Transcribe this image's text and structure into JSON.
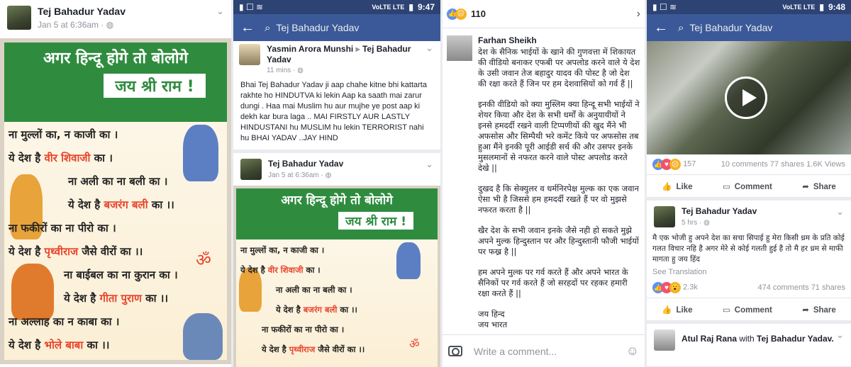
{
  "panel1": {
    "author": "Tej Bahadur Yadav",
    "time": "Jan 5 at 6:36am · ",
    "poster": {
      "headline": "अगर हिन्दू होगे तो बोलोगे",
      "jai": "जय श्री राम !",
      "lines": [
        {
          "pre": "ना मुल्लों का, न काजी का ।",
          "hl": "",
          "post": ""
        },
        {
          "pre": "ये देश है ",
          "hl": "वीर शिवाजी",
          "post": " का ।"
        },
        {
          "pre": "ना अली का ना बली का ।",
          "hl": "",
          "post": ""
        },
        {
          "pre": "ये देश है ",
          "hl": "बजरंग बली",
          "post": " का ।।"
        },
        {
          "pre": "ना फकीरों का ना पीरो का ।",
          "hl": "",
          "post": ""
        },
        {
          "pre": "ये देश है ",
          "hl": "पृथ्वीराज",
          "post": " जैसे वीरों का ।।"
        },
        {
          "pre": "ना बाईबल का ना कुरान का ।",
          "hl": "",
          "post": ""
        },
        {
          "pre": "ये देश है ",
          "hl": "गीता पुराण",
          "post": " का ।।"
        },
        {
          "pre": "ना अल्लाह का न काबा का ।",
          "hl": "",
          "post": ""
        },
        {
          "pre": "ये देश है ",
          "hl": "भोले बाबा",
          "post": " का ।।"
        }
      ]
    }
  },
  "panel2": {
    "status_time": "9:47",
    "status_net": "VoLTE LTE",
    "search_query": "Tej Bahadur Yadav",
    "share": {
      "author": "Yasmin Arora Munshi",
      "arrow": "▸",
      "target": "Tej Bahadur Yadav",
      "time": "11 mins · ",
      "text": "Bhai Tej Bahadur Yadav ji aap chahe kitne bhi kattarta rakhte ho HINDUTVA ki lekin Aap ka saath mai zarur dungi . Haa mai Muslim hu aur mujhe ye post aap ki dekh kar bura laga .. MAI FIRSTLY AUR LASTLY HINDUSTANI hu MUSLIM hu lekin TERRORIST nahi hu BHAI YADAV ..JAY HIND"
    },
    "inner": {
      "author": "Tej Bahadur Yadav",
      "time": "Jan 5 at 6:36am · "
    }
  },
  "panel3": {
    "reaction_count": "110",
    "commenter": "Farhan Sheikh",
    "paragraphs": [
      "देश के सैनिक भाईयों के खाने की गुणवत्ता में शिकायत की वीडियो बनाकर एफबी पर अपलोड करने वाले ये देश के उसी जवान तेज बहादुर यादव की पोस्ट है जो देश की रक्षा करते हैं जिन पर हम देशवासियों को गर्व हैं ||",
      "इनकी वीडियो को क्या मुस्लिम क्या हिन्दू सभी भाईयों ने शेयर किया और देश के सभी धर्मों के अनुयायीयों ने इनसे हमदर्दी रखने वाली टिप्पणीयों की खुद मैंने भी अफसोस और सिम्पैथी भरे कमेंट किये पर अफसोस तब हुआ मैंने इनकी पूरी आईडी सर्च की और उसपर इनके मुसलमानों से नफरत करने वाले पोस्ट अपलोड करते देखे ||",
      "दुखद है कि सेक्युलर व धर्मनिरपेक्ष मुल्क का एक जवान ऐसा भी है जिससे हम हमदर्दी रखते हैं पर वो मुझसे नफरत करता है ||",
      "खैर देश के सभी जवान इनके जैसे नही हो सकते मुझे अपने मुल्क हिन्दुस्तान पर और हिन्दुस्तानी फौजी भाईयों पर फख्र है ||",
      "हम अपने मुल्क पर गर्व करते हैं और अपने भारत के सैनिकों पर गर्व करते हैं जो सरहदों पर रहकर हमारी रक्षा करते हैं ||",
      "जय हिन्द\nजय भारत"
    ],
    "write_placeholder": "Write a comment..."
  },
  "panel4": {
    "status_time": "9:48",
    "status_net": "VoLTE LTE",
    "search_query": "Tej Bahadur Yadav",
    "video_stats": {
      "reactions": "157",
      "comments": "10 comments",
      "shares": "77 shares",
      "views": "1.6K Views"
    },
    "actions": {
      "like": "Like",
      "comment": "Comment",
      "share": "Share"
    },
    "post": {
      "author": "Tej Bahadur Yadav",
      "time": "5 hrs · ",
      "text": "मै एक भोजी हु अपने देश का सचा सिपाई हु मेरा किसी ध्रम के प्रति कोई गलत विचार नहि है अगर मेरे से कोई गलती हुई है तो मै हर ध्रम से माफी मागता हु जय हिंद",
      "see_translation": "See Translation",
      "reactions": "2.3k",
      "comments": "474 comments",
      "shares": "71 shares"
    },
    "next": {
      "author": "Atul Raj Rana",
      "with": " with ",
      "tagged": "Tej Bahadur Yadav."
    }
  },
  "colors": {
    "fb_blue": "#3b5998",
    "dark_blue": "#2d4373",
    "poster_green": "#2f8c3f",
    "highlight_red": "#e8442c"
  }
}
